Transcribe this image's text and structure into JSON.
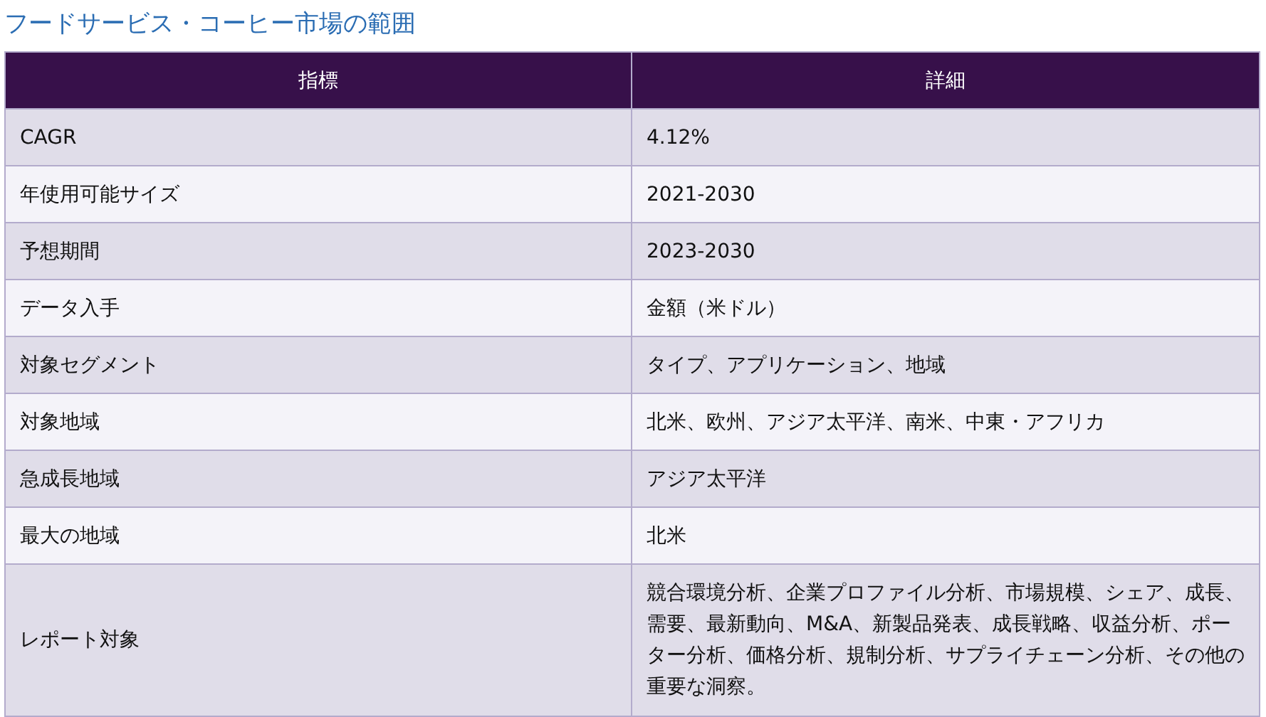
{
  "title": "フードサービス・コーヒー市場の範囲",
  "table": {
    "columns": [
      "指標",
      "詳細"
    ],
    "rows": [
      [
        "CAGR",
        "4.12%"
      ],
      [
        "年使用可能サイズ",
        "2021-2030"
      ],
      [
        "予想期間",
        "2023-2030"
      ],
      [
        "データ入手",
        "金額（米ドル）"
      ],
      [
        "対象セグメント",
        "タイプ、アプリケーション、地域"
      ],
      [
        "対象地域",
        "北米、欧州、アジア太平洋、南米、中東・アフリカ"
      ],
      [
        "急成長地域",
        "アジア太平洋"
      ],
      [
        "最大の地域",
        "北米"
      ],
      [
        "レポート対象",
        "競合環境分析、企業プロファイル分析、市場規模、シェア、成長、需要、最新動向、M&A、新製品発表、成長戦略、収益分析、ポーター分析、価格分析、規制分析、サプライチェーン分析、その他の重要な洞察。"
      ]
    ]
  }
}
